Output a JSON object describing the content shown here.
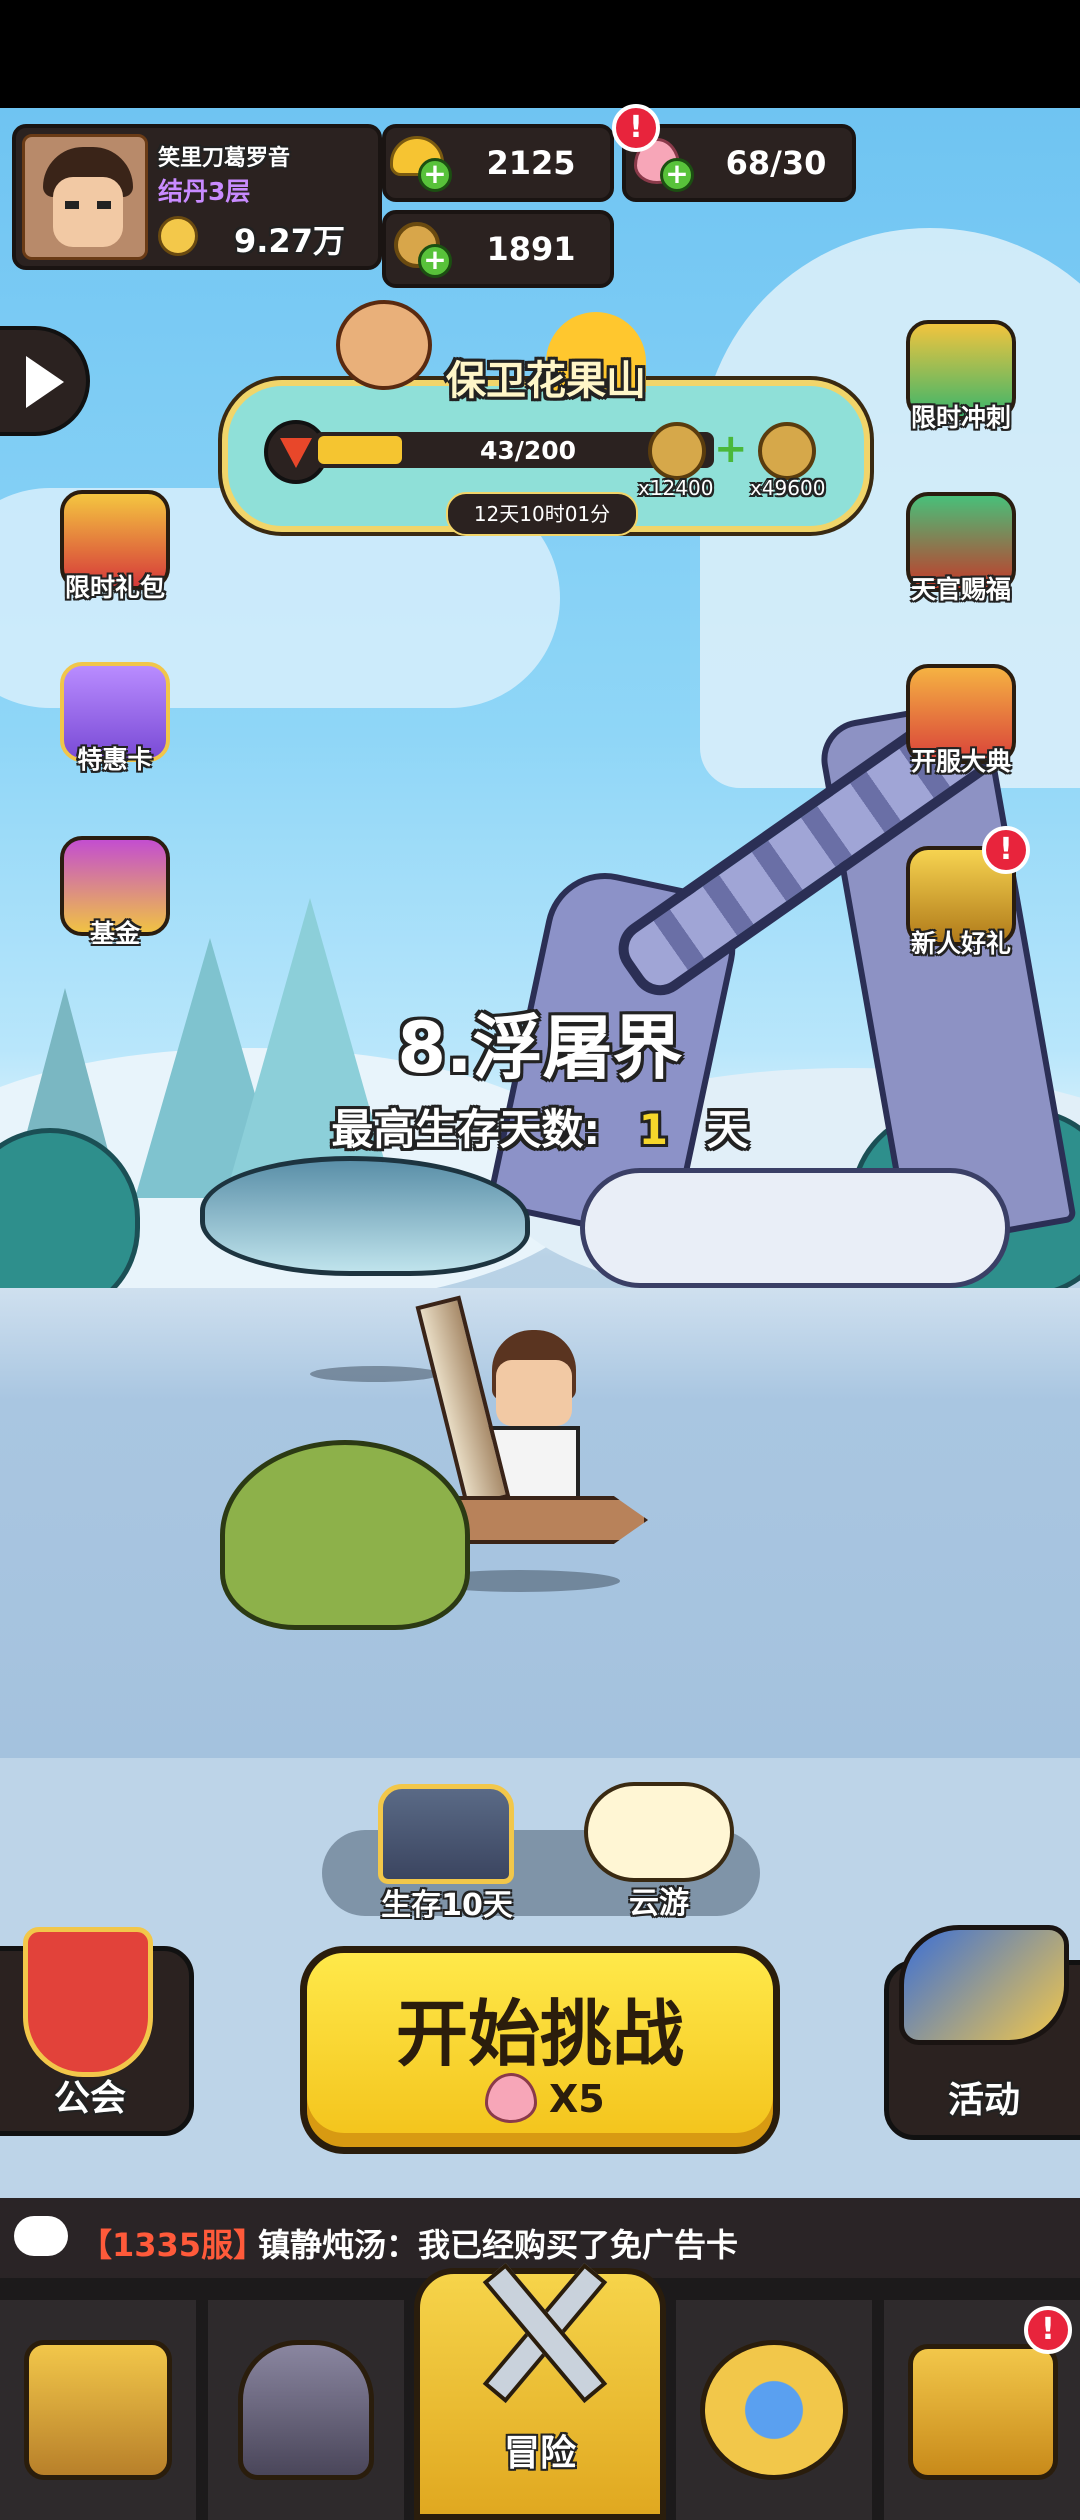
{
  "player": {
    "name": "笑里刀葛罗音",
    "realm": "结丹3层",
    "power": "9.27万"
  },
  "currency": {
    "gold": "2125",
    "stamina": "68/30",
    "coins": "1891"
  },
  "event": {
    "title": "保卫花果山",
    "progress_text": "43/200",
    "progress": 0.215,
    "reward1": "x12400",
    "reward2": "x49600",
    "timer": "12天10时01分"
  },
  "left_buttons": [
    "限时礼包",
    "特惠卡",
    "基金"
  ],
  "right_buttons": [
    "限时冲刺",
    "天官赐福",
    "开服大典",
    "新人好礼"
  ],
  "stage": {
    "name": "8.浮屠界",
    "record_label": "最高生存天数:",
    "record_value": "1",
    "record_unit": "天"
  },
  "chest_label": "生存10天",
  "cloud_label": "云游",
  "guild_label": "公会",
  "activity_label": "活动",
  "challenge": {
    "label": "开始挑战",
    "cost": "X5"
  },
  "chat": {
    "server": "【1335服】",
    "message": "镇静炖汤：我已经购买了免广告卡"
  },
  "nav": {
    "adventure": "冒险"
  },
  "badges": {
    "alert": "!"
  },
  "colors": {
    "gold": "#ffd84a",
    "purple": "#c98bff",
    "accent_yellow": "#f5d62b",
    "chat_server": "#ff5a3a"
  }
}
